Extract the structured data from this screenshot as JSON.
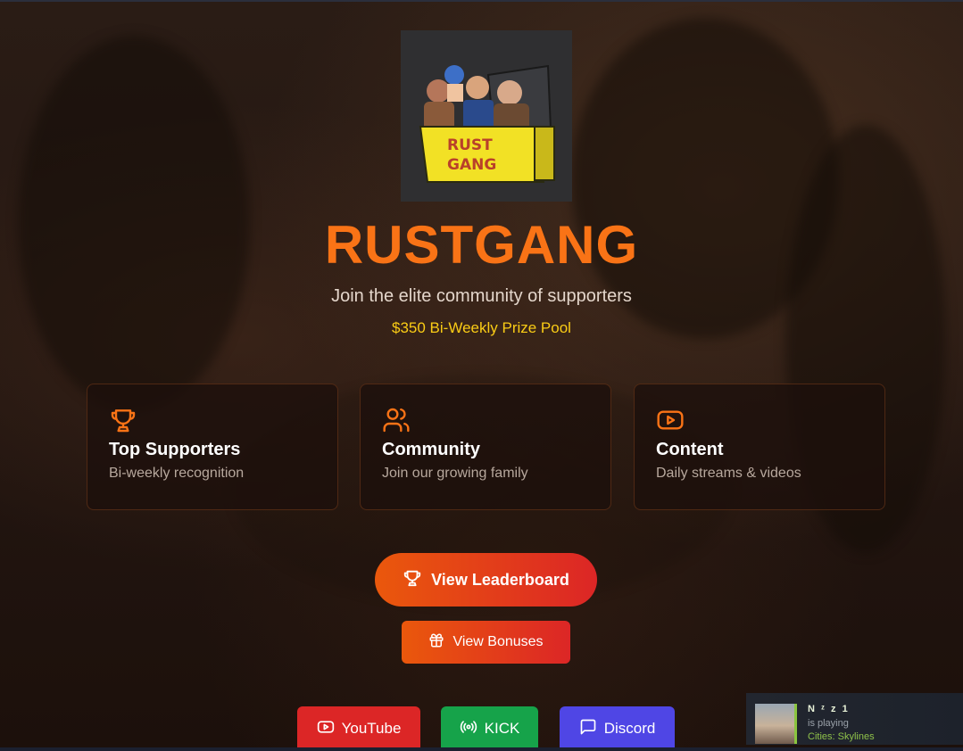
{
  "brand": {
    "title": "RUSTGANG",
    "tagline": "Join the elite community of supporters",
    "prize": "$350 Bi-Weekly Prize Pool",
    "logo_text": "RUST GANG",
    "accent": "#f97316",
    "prize_color": "#facc15"
  },
  "features": [
    {
      "icon": "trophy-icon",
      "title": "Top Supporters",
      "subtitle": "Bi-weekly recognition"
    },
    {
      "icon": "users-icon",
      "title": "Community",
      "subtitle": "Join our growing family"
    },
    {
      "icon": "video-icon",
      "title": "Content",
      "subtitle": "Daily streams & videos"
    }
  ],
  "actions": {
    "leaderboard_label": "View Leaderboard",
    "bonuses_label": "View Bonuses"
  },
  "socials": [
    {
      "label": "YouTube",
      "icon": "youtube-icon",
      "color": "#dc2626"
    },
    {
      "label": "KICK",
      "icon": "broadcast-icon",
      "color": "#16a34a"
    },
    {
      "label": "Discord",
      "icon": "chat-icon",
      "color": "#4f46e5"
    }
  ],
  "notification": {
    "name": "N ᶻ z 1",
    "status": "is playing",
    "game": "Cities: Skylines"
  }
}
